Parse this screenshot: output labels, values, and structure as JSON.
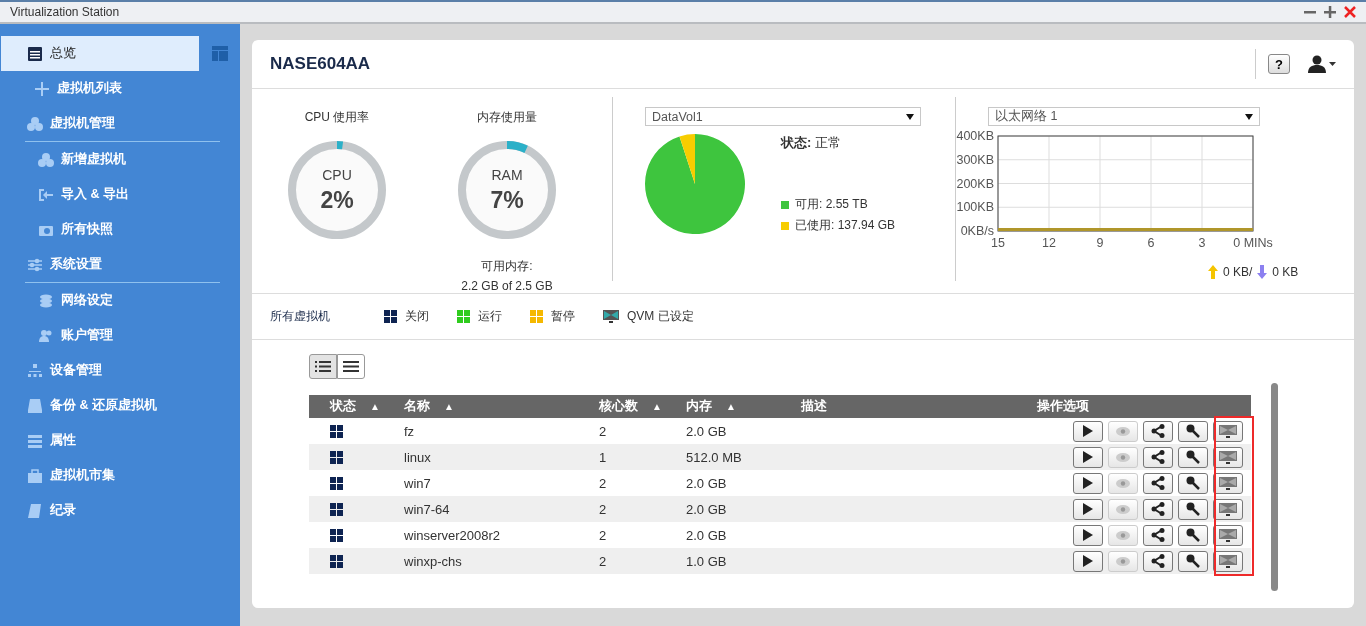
{
  "window": {
    "title": "Virtualization Station"
  },
  "sidebar": {
    "items": [
      {
        "label": "总览",
        "kind": "item",
        "selected": true,
        "children": [
          {
            "label": "虚拟机列表",
            "selected": false
          }
        ]
      },
      {
        "label": "虚拟机管理",
        "kind": "group",
        "selected": false,
        "children": [
          {
            "label": "新增虚拟机",
            "selected": false
          },
          {
            "label": "导入 & 导出",
            "selected": false
          },
          {
            "label": "所有快照",
            "selected": false
          }
        ]
      },
      {
        "label": "系统设置",
        "kind": "group",
        "selected": false,
        "children": [
          {
            "label": "网络设定",
            "selected": false
          },
          {
            "label": "账户管理",
            "selected": false
          }
        ]
      },
      {
        "label": "设备管理",
        "kind": "item",
        "selected": false
      },
      {
        "label": "备份 & 还原虚拟机",
        "kind": "item",
        "selected": false
      },
      {
        "label": "属性",
        "kind": "item",
        "selected": false
      },
      {
        "label": "虚拟机市集",
        "kind": "item",
        "selected": false
      },
      {
        "label": "纪录",
        "kind": "item",
        "selected": false
      }
    ]
  },
  "header": {
    "title": "NASE604AA",
    "help": "?"
  },
  "cpu": {
    "title": "CPU 使用率",
    "label": "CPU",
    "value": "2%",
    "level": 0.02
  },
  "memory": {
    "title": "内存使用量",
    "label": "RAM",
    "value": "7%",
    "level": 0.07,
    "free_label": "可用内存:",
    "free_value": "2.2 GB of 2.5 GB"
  },
  "storage": {
    "volume": "DataVol1",
    "status": "**状态:** 正常",
    "legend": [
      {
        "label": "可用: 2.55 TB",
        "color": "#3ec53e"
      },
      {
        "label": "已使用: 137.94 GB",
        "color": "#f7cd00"
      }
    ],
    "chart_data": {
      "type": "pie",
      "values": [
        94.98,
        5.02
      ]
    }
  },
  "network": {
    "interface": "以太网络 1",
    "upload": "0 KB/",
    "download": "0 KB",
    "chart_data": {
      "type": "line",
      "grid": true,
      "x": [
        15,
        12,
        9,
        6,
        3,
        0
      ],
      "xlim": [
        15,
        0
      ],
      "ylim": [
        0,
        400
      ],
      "series": [
        {
          "color": "#b0962a",
          "values": [
            0,
            0,
            0,
            0,
            0,
            0
          ]
        }
      ],
      "xticks": [
        15,
        12,
        9,
        6,
        3,
        {
          "value": 0,
          "label": "0 MINs"
        }
      ],
      "yticks": [
        {
          "value": 0,
          "label": "0KB/s"
        },
        {
          "value": 100,
          "label": "100KB"
        },
        {
          "value": 200,
          "label": "200KB"
        },
        {
          "value": 300,
          "label": "300KB"
        },
        {
          "value": 400,
          "label": "400KB"
        }
      ]
    }
  },
  "legend": {
    "title": "所有虚拟机",
    "items": [
      {
        "label": "关闭",
        "kind": "grid",
        "color": "#0e2452"
      },
      {
        "label": "运行",
        "kind": "grid",
        "color": "#2fcc1e"
      },
      {
        "label": "暂停",
        "kind": "grid",
        "color": "#f5b800"
      },
      {
        "label": "QVM 已设定",
        "kind": "monitor"
      }
    ]
  },
  "view_modes": [
    {
      "kind": "detail",
      "selected": true
    },
    {
      "kind": "list",
      "selected": false
    }
  ],
  "table": {
    "last_column_highlighted": true,
    "columns": [
      {
        "label": "状态",
        "sort": "▲"
      },
      {
        "label": "名称",
        "sort": "▲"
      },
      {
        "label": "核心数",
        "sort": "▲"
      },
      {
        "label": "内存",
        "sort": "▲"
      },
      {
        "label": "描述"
      },
      {
        "label": "操作选项"
      }
    ],
    "rows": [
      {
        "color": "#0e2452",
        "name": "fz",
        "cores": "2",
        "memory": "2.0 GB",
        "actions": [
          {
            "kind": "play",
            "disabled": false
          },
          {
            "kind": "view",
            "disabled": true
          },
          {
            "kind": "share",
            "disabled": false
          },
          {
            "kind": "key",
            "disabled": false
          },
          {
            "kind": "console",
            "disabled": false
          }
        ]
      },
      {
        "color": "#0e2452",
        "name": "linux",
        "cores": "1",
        "memory": "512.0 MB",
        "actions": [
          {
            "kind": "play",
            "disabled": false
          },
          {
            "kind": "view",
            "disabled": true
          },
          {
            "kind": "share",
            "disabled": false
          },
          {
            "kind": "key",
            "disabled": false
          },
          {
            "kind": "console",
            "disabled": false
          }
        ]
      },
      {
        "color": "#0e2452",
        "name": "win7",
        "cores": "2",
        "memory": "2.0 GB",
        "actions": [
          {
            "kind": "play",
            "disabled": false
          },
          {
            "kind": "view",
            "disabled": true
          },
          {
            "kind": "share",
            "disabled": false
          },
          {
            "kind": "key",
            "disabled": false
          },
          {
            "kind": "console",
            "disabled": false
          }
        ]
      },
      {
        "color": "#0e2452",
        "name": "win7-64",
        "cores": "2",
        "memory": "2.0 GB",
        "actions": [
          {
            "kind": "play",
            "disabled": false
          },
          {
            "kind": "view",
            "disabled": true
          },
          {
            "kind": "share",
            "disabled": false
          },
          {
            "kind": "key",
            "disabled": false
          },
          {
            "kind": "console",
            "disabled": false
          }
        ]
      },
      {
        "color": "#0e2452",
        "name": "winserver2008r2",
        "cores": "2",
        "memory": "2.0 GB",
        "actions": [
          {
            "kind": "play",
            "disabled": false
          },
          {
            "kind": "view",
            "disabled": true
          },
          {
            "kind": "share",
            "disabled": false
          },
          {
            "kind": "key",
            "disabled": false
          },
          {
            "kind": "console",
            "disabled": false
          }
        ]
      },
      {
        "color": "#0e2452",
        "name": "winxp-chs",
        "cores": "2",
        "memory": "1.0 GB",
        "actions": [
          {
            "kind": "play",
            "disabled": false
          },
          {
            "kind": "view",
            "disabled": true
          },
          {
            "kind": "share",
            "disabled": false
          },
          {
            "kind": "key",
            "disabled": false
          },
          {
            "kind": "console",
            "disabled": false
          }
        ]
      }
    ]
  }
}
